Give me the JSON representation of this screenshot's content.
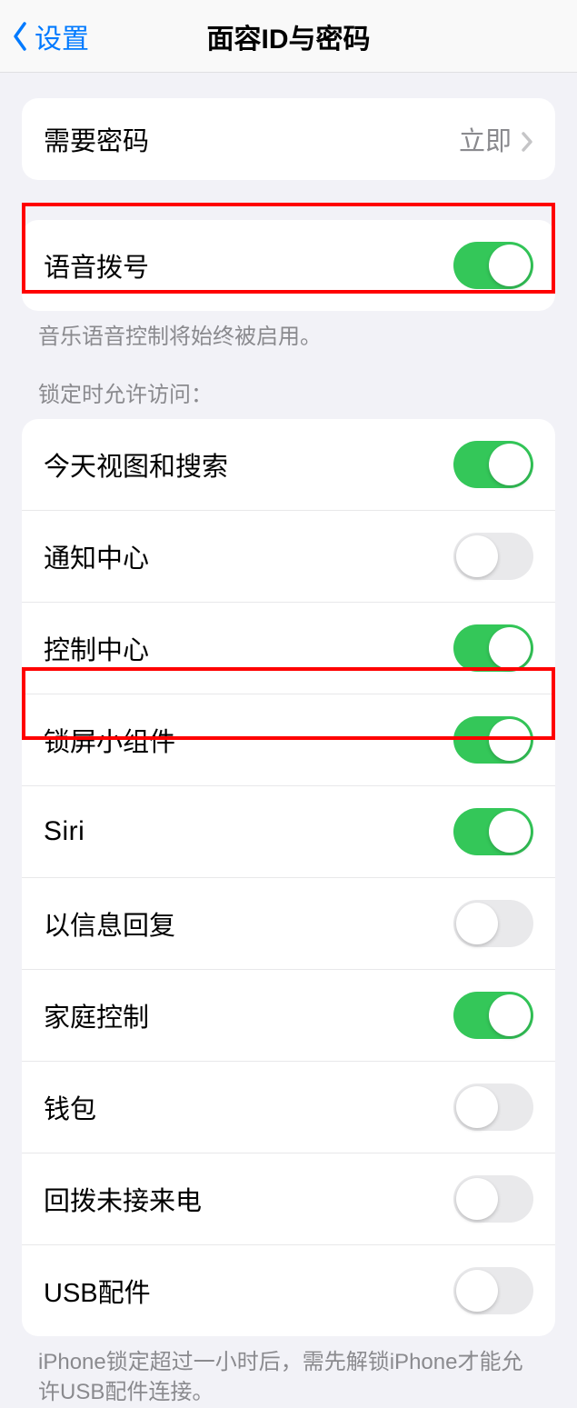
{
  "nav": {
    "back_label": "设置",
    "title": "面容ID与密码"
  },
  "require_passcode": {
    "label": "需要密码",
    "value": "立即"
  },
  "voice_dial": {
    "label": "语音拨号",
    "on": true,
    "footer": "音乐语音控制将始终被启用。"
  },
  "lock_access": {
    "header": "锁定时允许访问：",
    "items": [
      {
        "label": "今天视图和搜索",
        "on": true
      },
      {
        "label": "通知中心",
        "on": false
      },
      {
        "label": "控制中心",
        "on": true
      },
      {
        "label": "锁屏小组件",
        "on": true
      },
      {
        "label": "Siri",
        "on": true
      },
      {
        "label": "以信息回复",
        "on": false
      },
      {
        "label": "家庭控制",
        "on": true
      },
      {
        "label": "钱包",
        "on": false
      },
      {
        "label": "回拨未接来电",
        "on": false
      },
      {
        "label": "USB配件",
        "on": false
      }
    ],
    "footer": "iPhone锁定超过一小时后，需先解锁iPhone才能允许USB配件连接。"
  }
}
